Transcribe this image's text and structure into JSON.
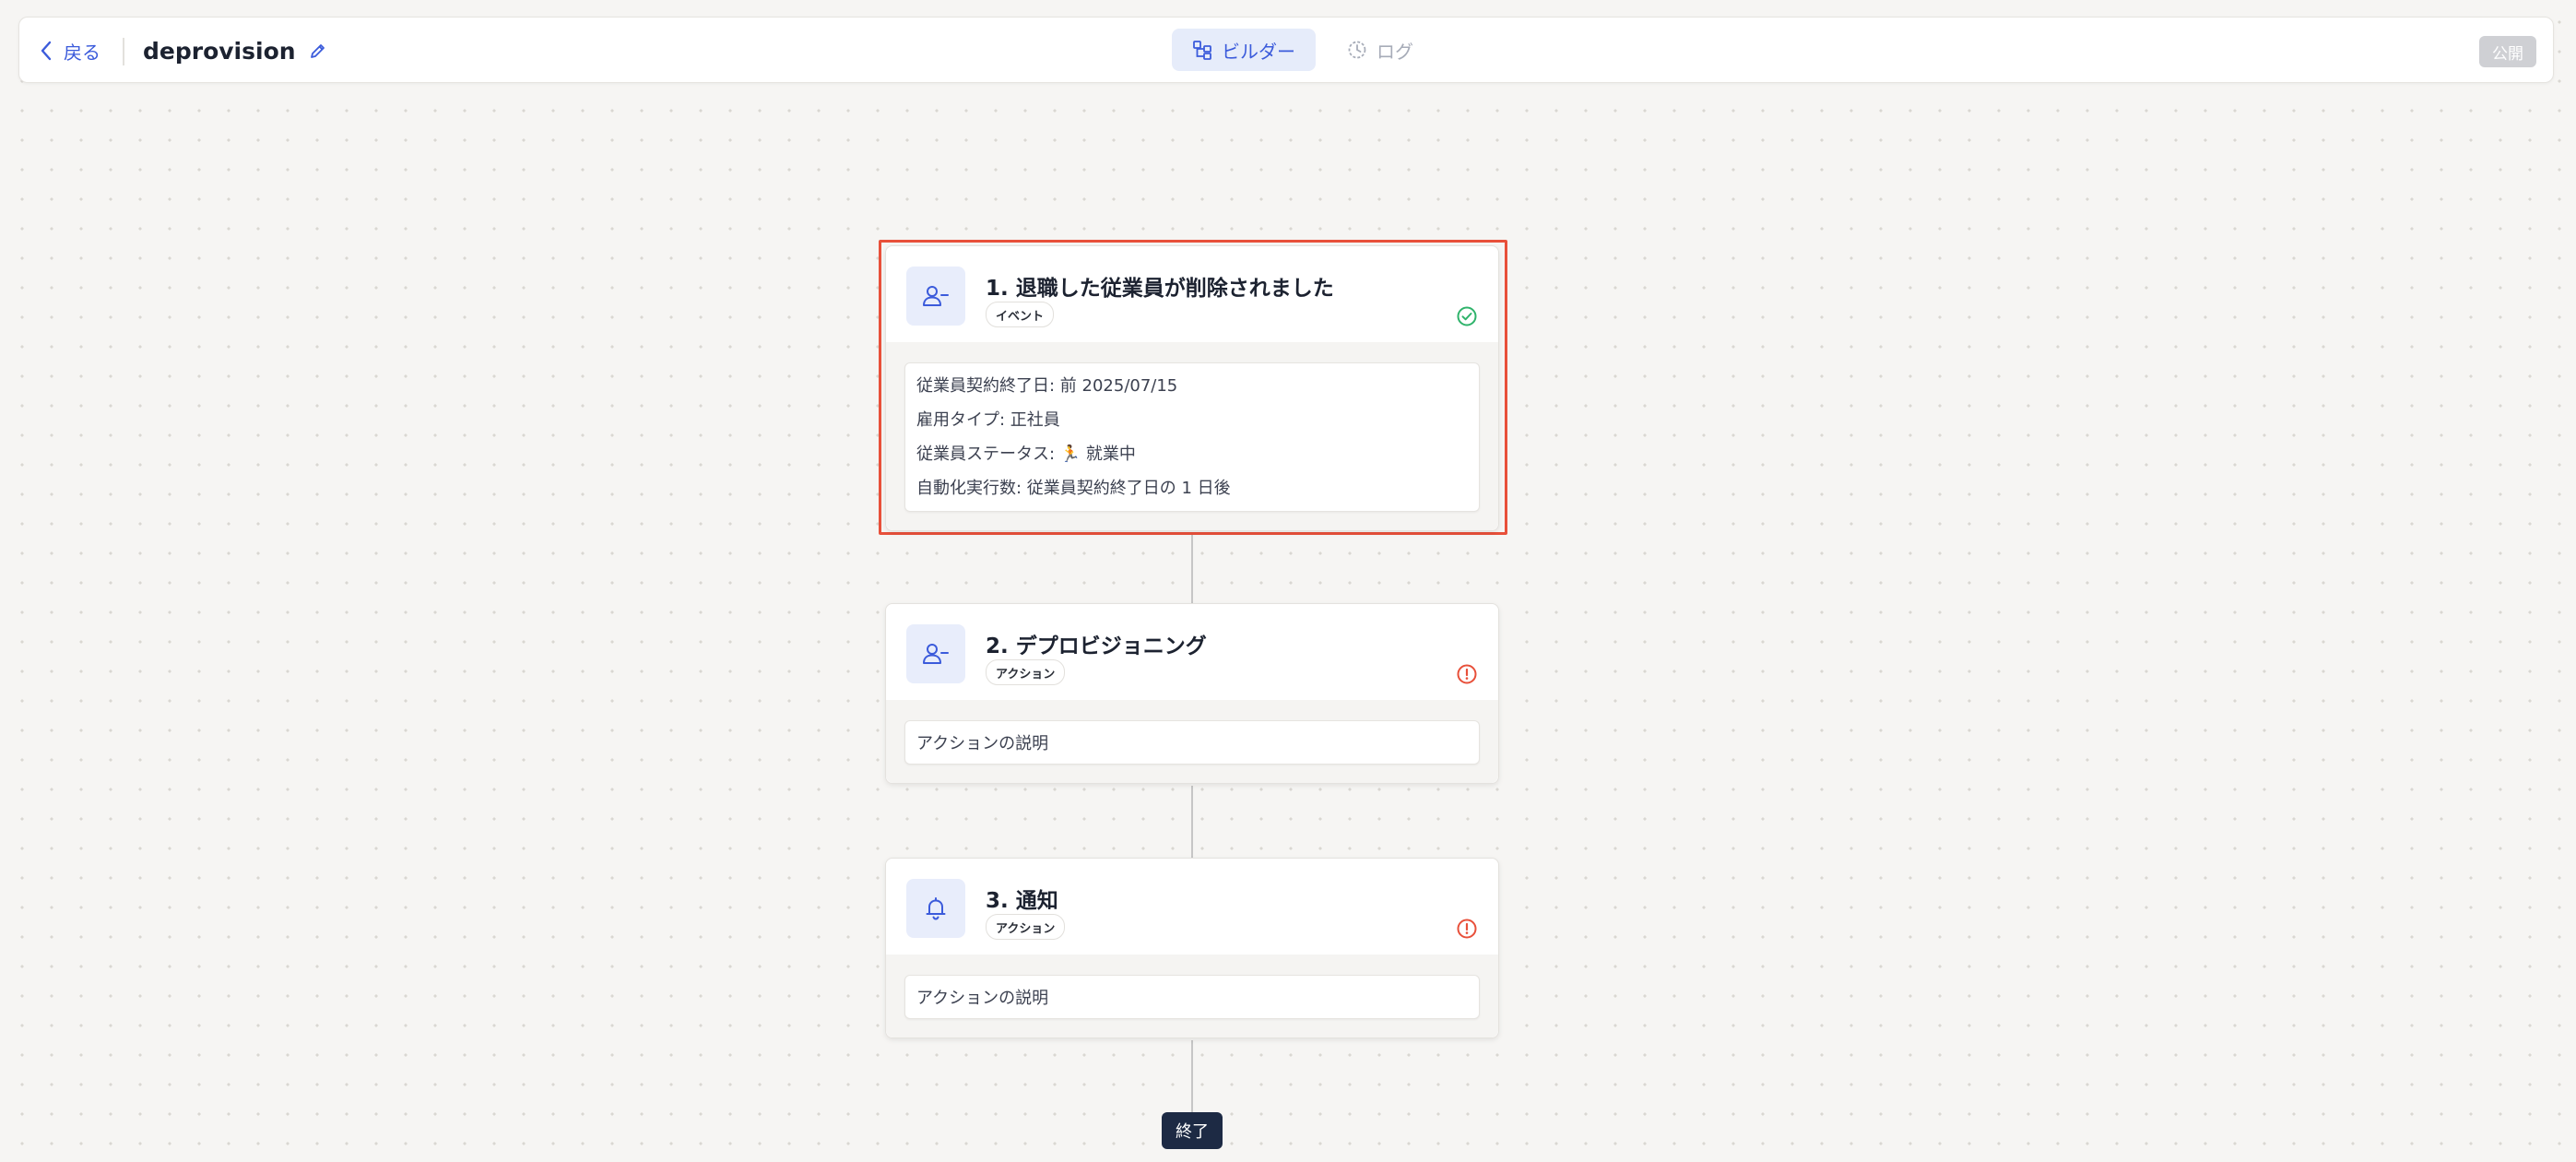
{
  "header": {
    "back_label": "戻る",
    "title": "deprovision",
    "tabs": [
      {
        "label": "ビルダー",
        "active": true
      },
      {
        "label": "ログ",
        "active": false
      }
    ],
    "publish_label": "公開"
  },
  "steps": [
    {
      "title": "1. 退職した従業員が削除されました",
      "badge": "イベント",
      "icon": "user-minus-icon",
      "status": "check-circle-icon",
      "details": [
        "従業員契約終了日: 前 2025/07/15",
        "雇用タイプ: 正社員",
        "従業員ステータス: 🏃 就業中",
        "自動化実行数: 従業員契約終了日の 1 日後"
      ]
    },
    {
      "title": "2. デプロビジョニング",
      "badge": "アクション",
      "icon": "user-minus-icon",
      "status": "alert-circle-icon",
      "description": "アクションの説明"
    },
    {
      "title": "3. 通知",
      "badge": "アクション",
      "icon": "bell-icon",
      "status": "alert-circle-icon",
      "description": "アクションの説明"
    }
  ],
  "end_label": "終了",
  "colors": {
    "accent": "#3b5bdb",
    "success": "#2fb36b",
    "error": "#e8503a",
    "end_badge": "#1d2a44"
  }
}
